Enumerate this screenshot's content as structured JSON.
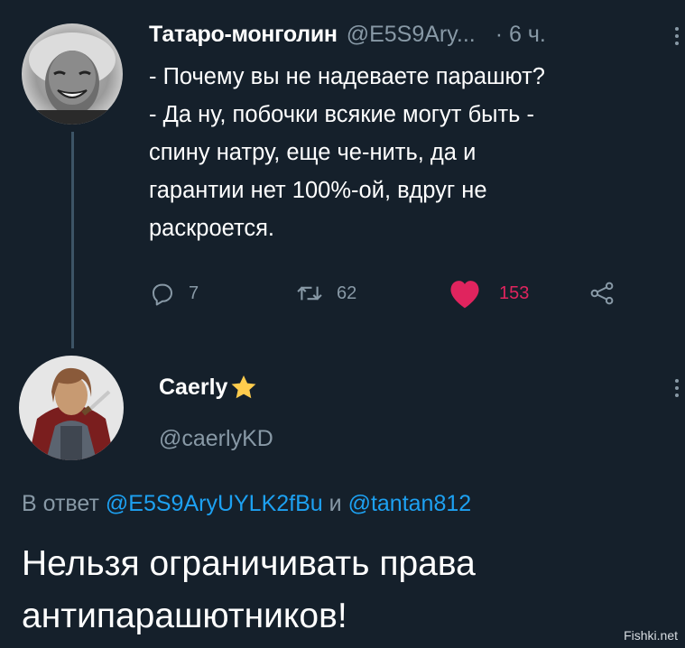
{
  "tweet1": {
    "name": "Татаро-монголин",
    "handle": "@E5S9Ary...",
    "time": "· 6 ч.",
    "lines": [
      "- Почему вы не надеваете парашют?",
      "- Да ну, побочки всякие могут быть -",
      "спину натру, еще че-нить, да и",
      "гарантии нет 100%-ой, вдруг не",
      "раскроется."
    ],
    "replies": "7",
    "retweets": "62",
    "likes": "153",
    "icons": {
      "reply": "reply-icon",
      "retweet": "retweet-icon",
      "like": "heart-icon",
      "share": "share-icon",
      "menu": "more-icon"
    }
  },
  "tweet2": {
    "name": "Caerly",
    "badge": "★",
    "handle": "@caerlyKD",
    "reply_prefix": "В ответ",
    "reply_user1": "@E5S9AryUYLK2fBu",
    "reply_and": "и",
    "reply_user2": "@tantan812",
    "lines": [
      "Нельзя ограничивать права",
      "антипарашютников!"
    ]
  },
  "watermark": "Fishki.net",
  "colors": {
    "background": "#15202b",
    "secondary_text": "#8899a6",
    "link": "#1da1f2",
    "like": "#e0245e",
    "star": "#ffcc4d"
  }
}
